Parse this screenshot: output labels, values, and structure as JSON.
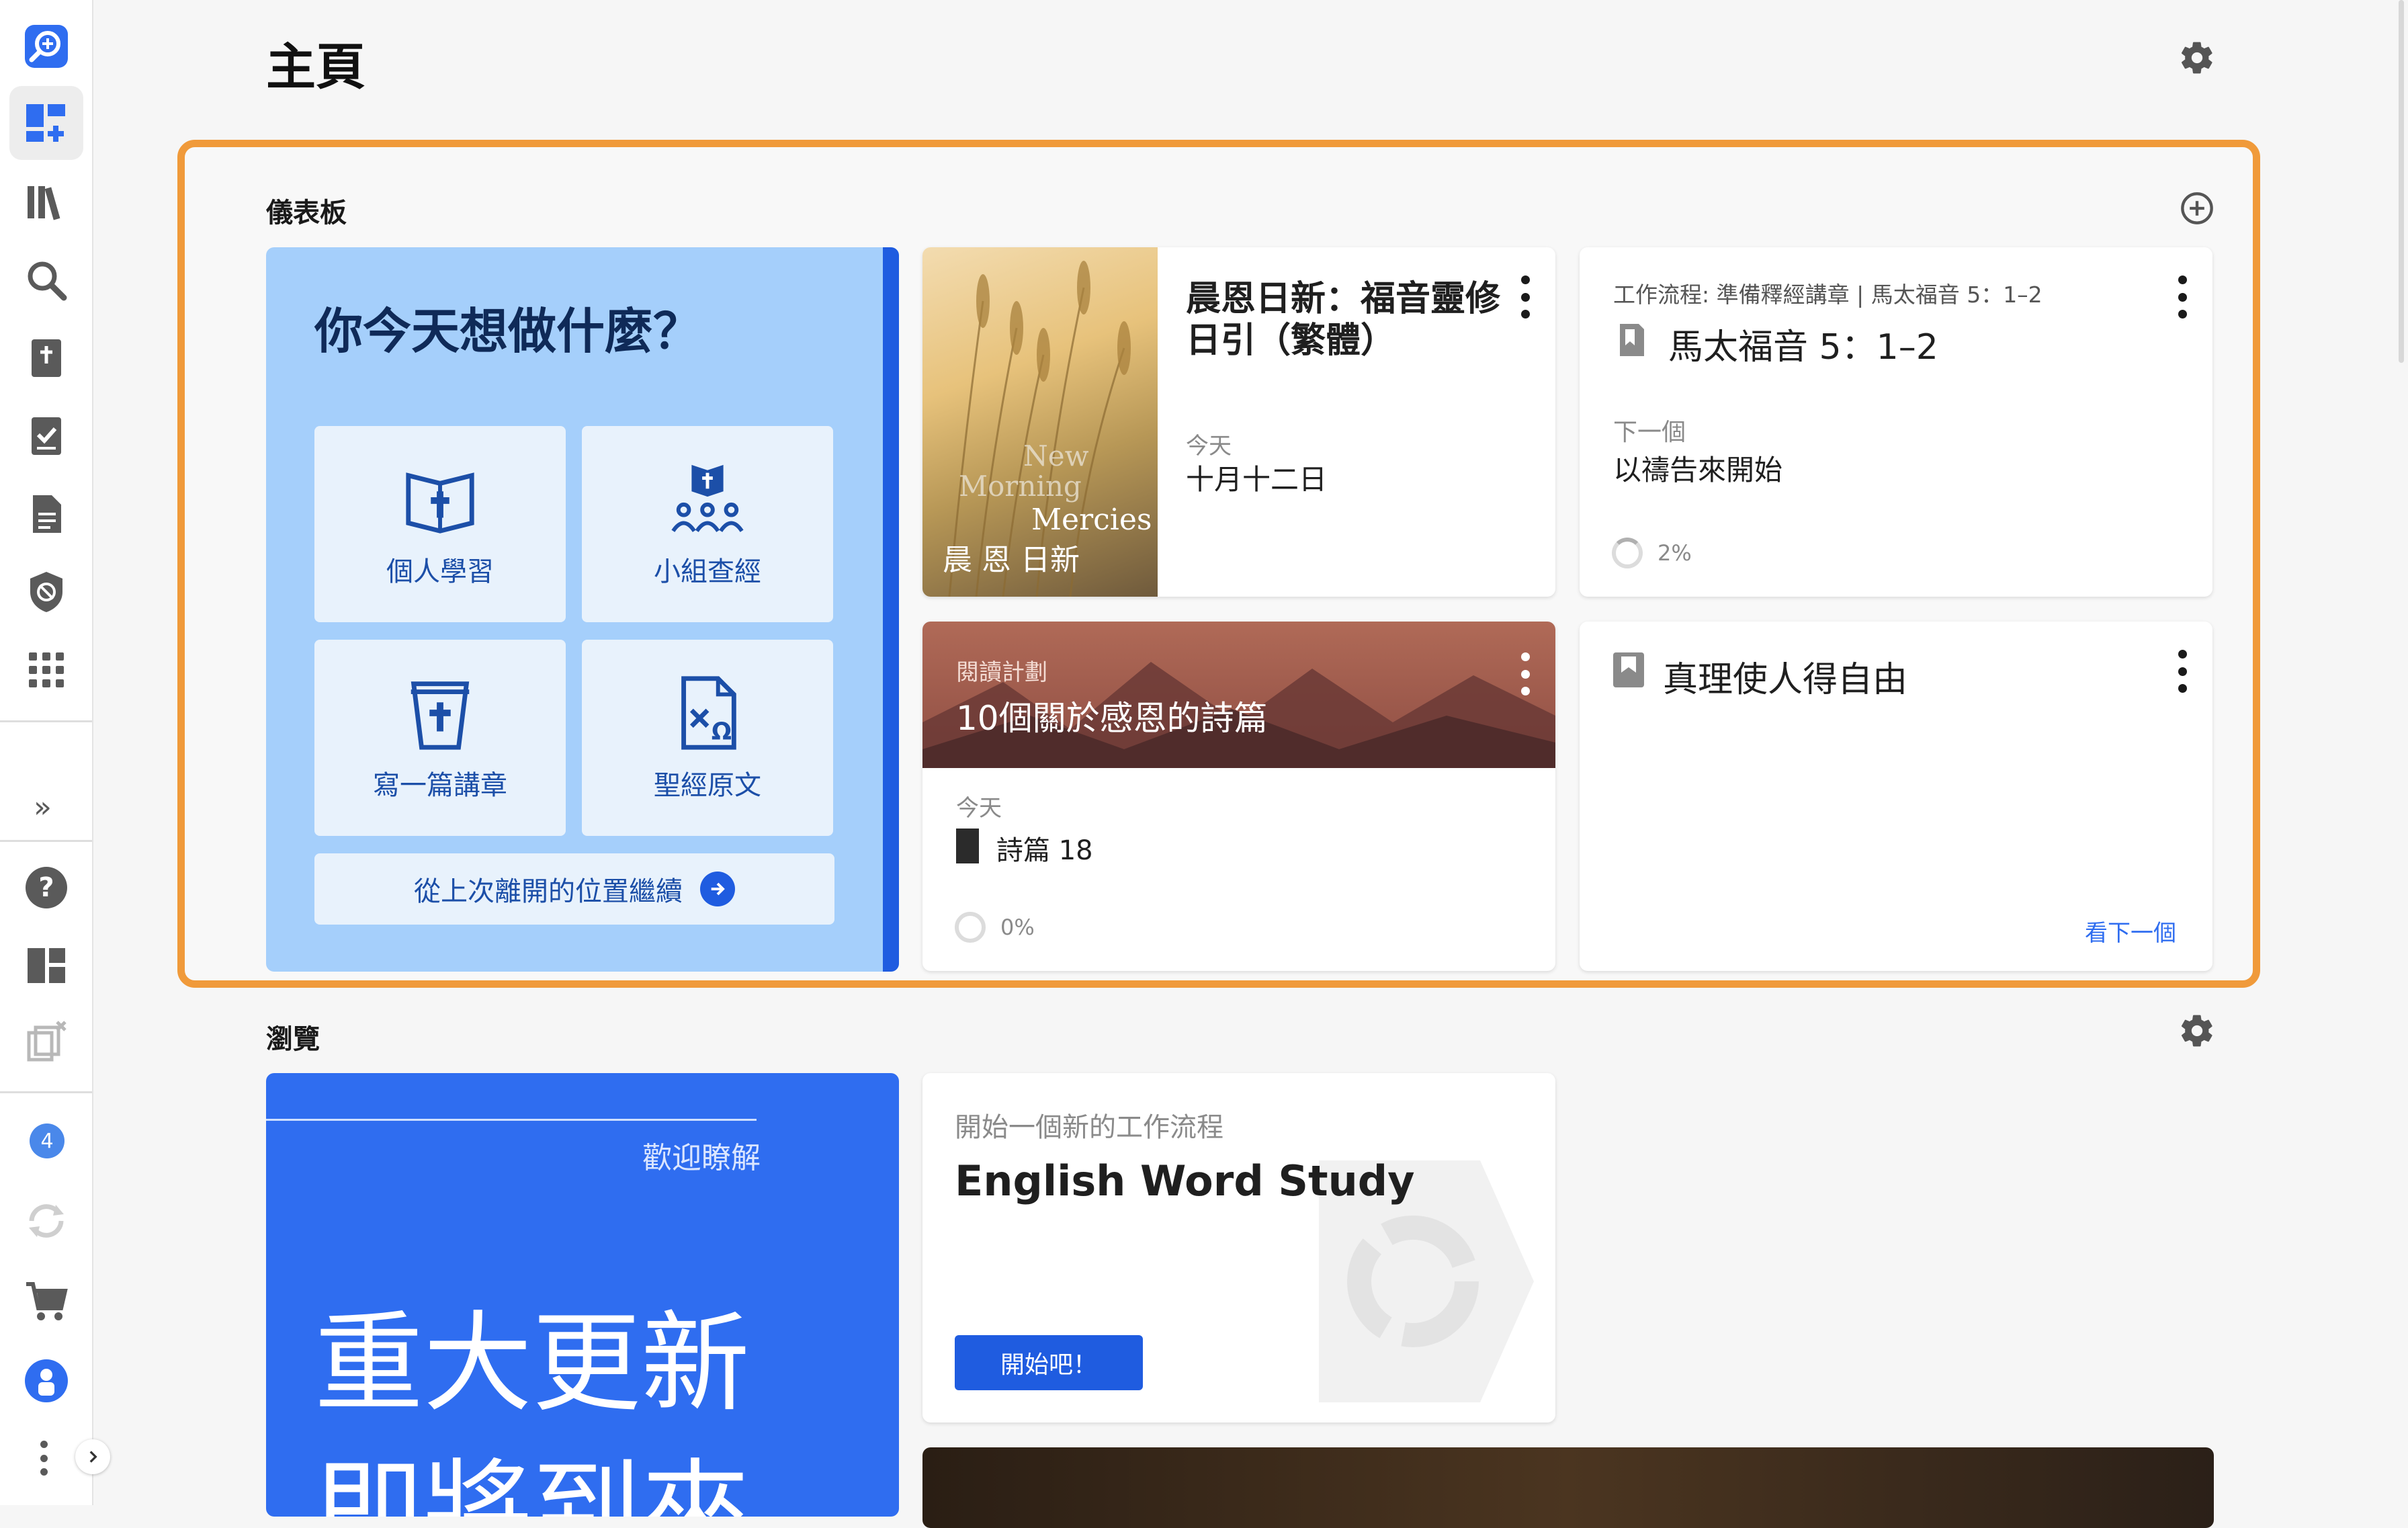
{
  "header": {
    "title": "主頁"
  },
  "sidebar": {
    "items": [
      {
        "name": "logo-search-icon"
      },
      {
        "name": "dashboard-add-icon",
        "active": true
      },
      {
        "name": "library-icon"
      },
      {
        "name": "search-icon"
      },
      {
        "name": "bible-icon"
      },
      {
        "name": "checklist-icon"
      },
      {
        "name": "document-icon"
      },
      {
        "name": "shield-icon"
      },
      {
        "name": "apps-grid-icon"
      }
    ],
    "expand_label": "»",
    "help_label": "?",
    "badge_count": "4"
  },
  "dashboard": {
    "title": "儀表板",
    "welcome": {
      "question": "你今天想做什麼？",
      "tiles": [
        {
          "label": "個人學習",
          "icon": "open-book-cross-icon"
        },
        {
          "label": "小組查經",
          "icon": "group-study-icon"
        },
        {
          "label": "寫一篇講章",
          "icon": "sermon-cup-icon"
        },
        {
          "label": "聖經原文",
          "icon": "original-language-icon"
        }
      ],
      "continue_label": "從上次離開的位置繼續"
    },
    "devotional": {
      "title": "晨恩日新：福音靈修日引（繁體）",
      "date_label": "今天",
      "date": "十月十二日",
      "cover_text_en": "New Morning Mercies",
      "cover_text_zh": "晨恩日新"
    },
    "workflow": {
      "subtitle": "工作流程: 準備釋經講章 | 馬太福音 5：1–2",
      "title": "馬太福音 5：1–2",
      "next_label": "下一個",
      "next_step": "以禱告來開始",
      "progress": "2%"
    },
    "reading_plan": {
      "kicker": "閱讀計劃",
      "title": "10個關於感恩的詩篇",
      "date_label": "今天",
      "reading": "詩篇 18",
      "progress": "0%"
    },
    "truth": {
      "title": "真理使人得自由",
      "link": "看下一個"
    }
  },
  "browse": {
    "title": "瀏覽",
    "update": {
      "kicker": "歡迎瞭解",
      "headline_1": "重大更新",
      "headline_2": "即將到來"
    },
    "workflow_start": {
      "kicker": "開始一個新的工作流程",
      "title": "English Word Study",
      "button": "開始吧！"
    }
  },
  "colors": {
    "accent_orange": "#f09a3a",
    "brand_blue": "#1f5ce0",
    "welcome_bg": "#a5cffb"
  }
}
